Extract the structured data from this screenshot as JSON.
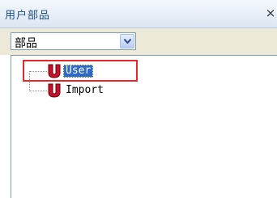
{
  "panel": {
    "title": "用户部品",
    "close_glyph": "×"
  },
  "combo": {
    "value": "部品"
  },
  "tree": {
    "items": [
      {
        "label": "User",
        "icon": "u-component-icon",
        "selected": true
      },
      {
        "label": "Import",
        "icon": "u-component-icon",
        "selected": false
      }
    ]
  },
  "colors": {
    "title_text": "#1a4f8c",
    "selection": "#316ac5",
    "highlight_box": "#e8262a",
    "icon_red": "#c8102e"
  }
}
